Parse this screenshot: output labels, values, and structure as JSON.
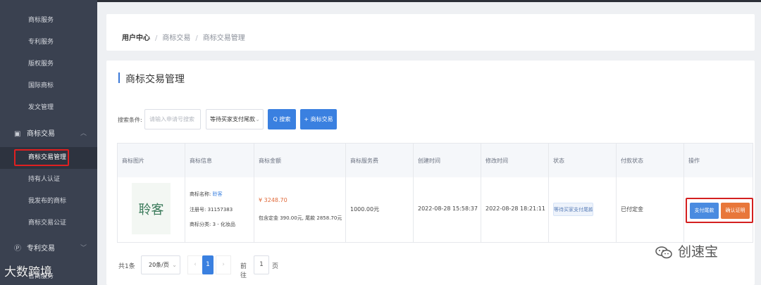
{
  "sidebar": {
    "items_top": [
      {
        "label": "商标服务"
      },
      {
        "label": "专利服务"
      },
      {
        "label": "版权服务"
      },
      {
        "label": "国际商标"
      },
      {
        "label": "发文管理"
      }
    ],
    "group_trademark": {
      "label": "商标交易",
      "icon": "cart-icon"
    },
    "items_trademark": [
      {
        "label": "商标交易管理",
        "active": true
      },
      {
        "label": "持有人认证"
      },
      {
        "label": "我发布的商标"
      },
      {
        "label": "商标交易公证"
      }
    ],
    "group_patent": {
      "label": "专利交易",
      "icon": "p-circle-icon"
    },
    "last_item": {
      "label": "官商服务"
    }
  },
  "breadcrumb": {
    "home": "用户中心",
    "level1": "商标交易",
    "level2": "商标交易管理"
  },
  "page": {
    "title": "商标交易管理",
    "accent_color": "#3a78d8"
  },
  "search": {
    "label": "搜索条件:",
    "placeholder": "请输入申请号搜索",
    "status_value": "等待买家支付尾款",
    "search_label": "Q 搜索",
    "add_label": "+ 商标交易"
  },
  "table": {
    "headers": [
      "商标图片",
      "商标信息",
      "商标金额",
      "商标服务费",
      "创建时间",
      "修改时间",
      "状态",
      "付款状态",
      "操作"
    ],
    "row": {
      "logo_text": "聆客",
      "name_label": "商标名称:",
      "name_value": "聆客",
      "reg_no": "注册号: 31157383",
      "category": "商标分类: 3 - 化妆品",
      "price": "¥ 3248.70",
      "price_detail": "包含定金 390.00元, 尾款 2858.70元",
      "service_fee": "1000.00元",
      "created": "2022-08-28 15:58:37",
      "modified": "2022-08-28 18:21:11",
      "status": "等待买家支付尾款",
      "pay_status": "已付定金",
      "btn_pay": "支付尾款",
      "btn_confirm": "确认证明"
    }
  },
  "pagination": {
    "total": "共1条",
    "page_size": "20条/页",
    "prev": "‹",
    "current": "1",
    "next": "›",
    "goto": "前往",
    "goto_value": "1",
    "unit": "页"
  },
  "watermarks": {
    "left": "大数跨境",
    "right": "创速宝"
  }
}
